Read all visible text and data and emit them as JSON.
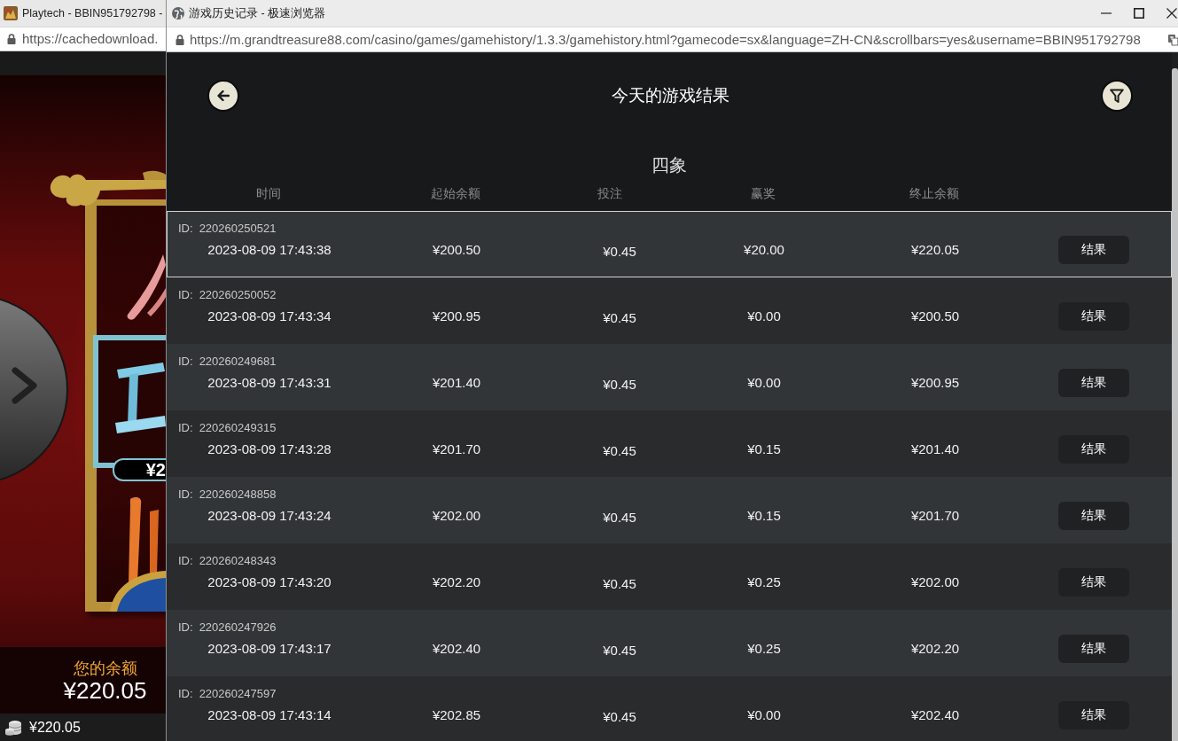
{
  "background_window": {
    "tab_title": "Playtech - BBIN951792798 -",
    "address": "https://cachedownload.",
    "game": {
      "win_tag": "¥2",
      "balance_label": "您的余额",
      "balance": "¥220.05"
    },
    "status_bar": {
      "balance": "¥220.05"
    }
  },
  "window": {
    "title": "游戏历史记录 - 极速浏览器",
    "address": "https://m.grandtreasure88.com/casino/games/gamehistory/1.3.3/gamehistory.html?gamecode=sx&language=ZH-CN&scrollbars=yes&username=BBIN951792798"
  },
  "header": {
    "title": "今天的游戏结果"
  },
  "game_name": "四象",
  "table": {
    "columns": [
      "时间",
      "起始余额",
      "投注",
      "赢奖",
      "终止余额"
    ],
    "rows": [
      {
        "id_label": "ID:",
        "id": "220260250521",
        "time": "2023-08-09 17:43:38",
        "start_balance": "¥200.50",
        "bet": "¥0.45",
        "win": "¥20.00",
        "end_balance": "¥220.05",
        "action": "结果",
        "selected": true
      },
      {
        "id_label": "ID:",
        "id": "220260250052",
        "time": "2023-08-09 17:43:34",
        "start_balance": "¥200.95",
        "bet": "¥0.45",
        "win": "¥0.00",
        "end_balance": "¥200.50",
        "action": "结果",
        "selected": false
      },
      {
        "id_label": "ID:",
        "id": "220260249681",
        "time": "2023-08-09 17:43:31",
        "start_balance": "¥201.40",
        "bet": "¥0.45",
        "win": "¥0.00",
        "end_balance": "¥200.95",
        "action": "结果",
        "selected": false
      },
      {
        "id_label": "ID:",
        "id": "220260249315",
        "time": "2023-08-09 17:43:28",
        "start_balance": "¥201.70",
        "bet": "¥0.45",
        "win": "¥0.15",
        "end_balance": "¥201.40",
        "action": "结果",
        "selected": false
      },
      {
        "id_label": "ID:",
        "id": "220260248858",
        "time": "2023-08-09 17:43:24",
        "start_balance": "¥202.00",
        "bet": "¥0.45",
        "win": "¥0.15",
        "end_balance": "¥201.70",
        "action": "结果",
        "selected": false
      },
      {
        "id_label": "ID:",
        "id": "220260248343",
        "time": "2023-08-09 17:43:20",
        "start_balance": "¥202.20",
        "bet": "¥0.45",
        "win": "¥0.25",
        "end_balance": "¥202.00",
        "action": "结果",
        "selected": false
      },
      {
        "id_label": "ID:",
        "id": "220260247926",
        "time": "2023-08-09 17:43:17",
        "start_balance": "¥202.40",
        "bet": "¥0.45",
        "win": "¥0.25",
        "end_balance": "¥202.20",
        "action": "结果",
        "selected": false
      },
      {
        "id_label": "ID:",
        "id": "220260247597",
        "time": "2023-08-09 17:43:14",
        "start_balance": "¥202.85",
        "bet": "¥0.45",
        "win": "¥0.00",
        "end_balance": "¥202.40",
        "action": "结果",
        "selected": false
      }
    ]
  }
}
